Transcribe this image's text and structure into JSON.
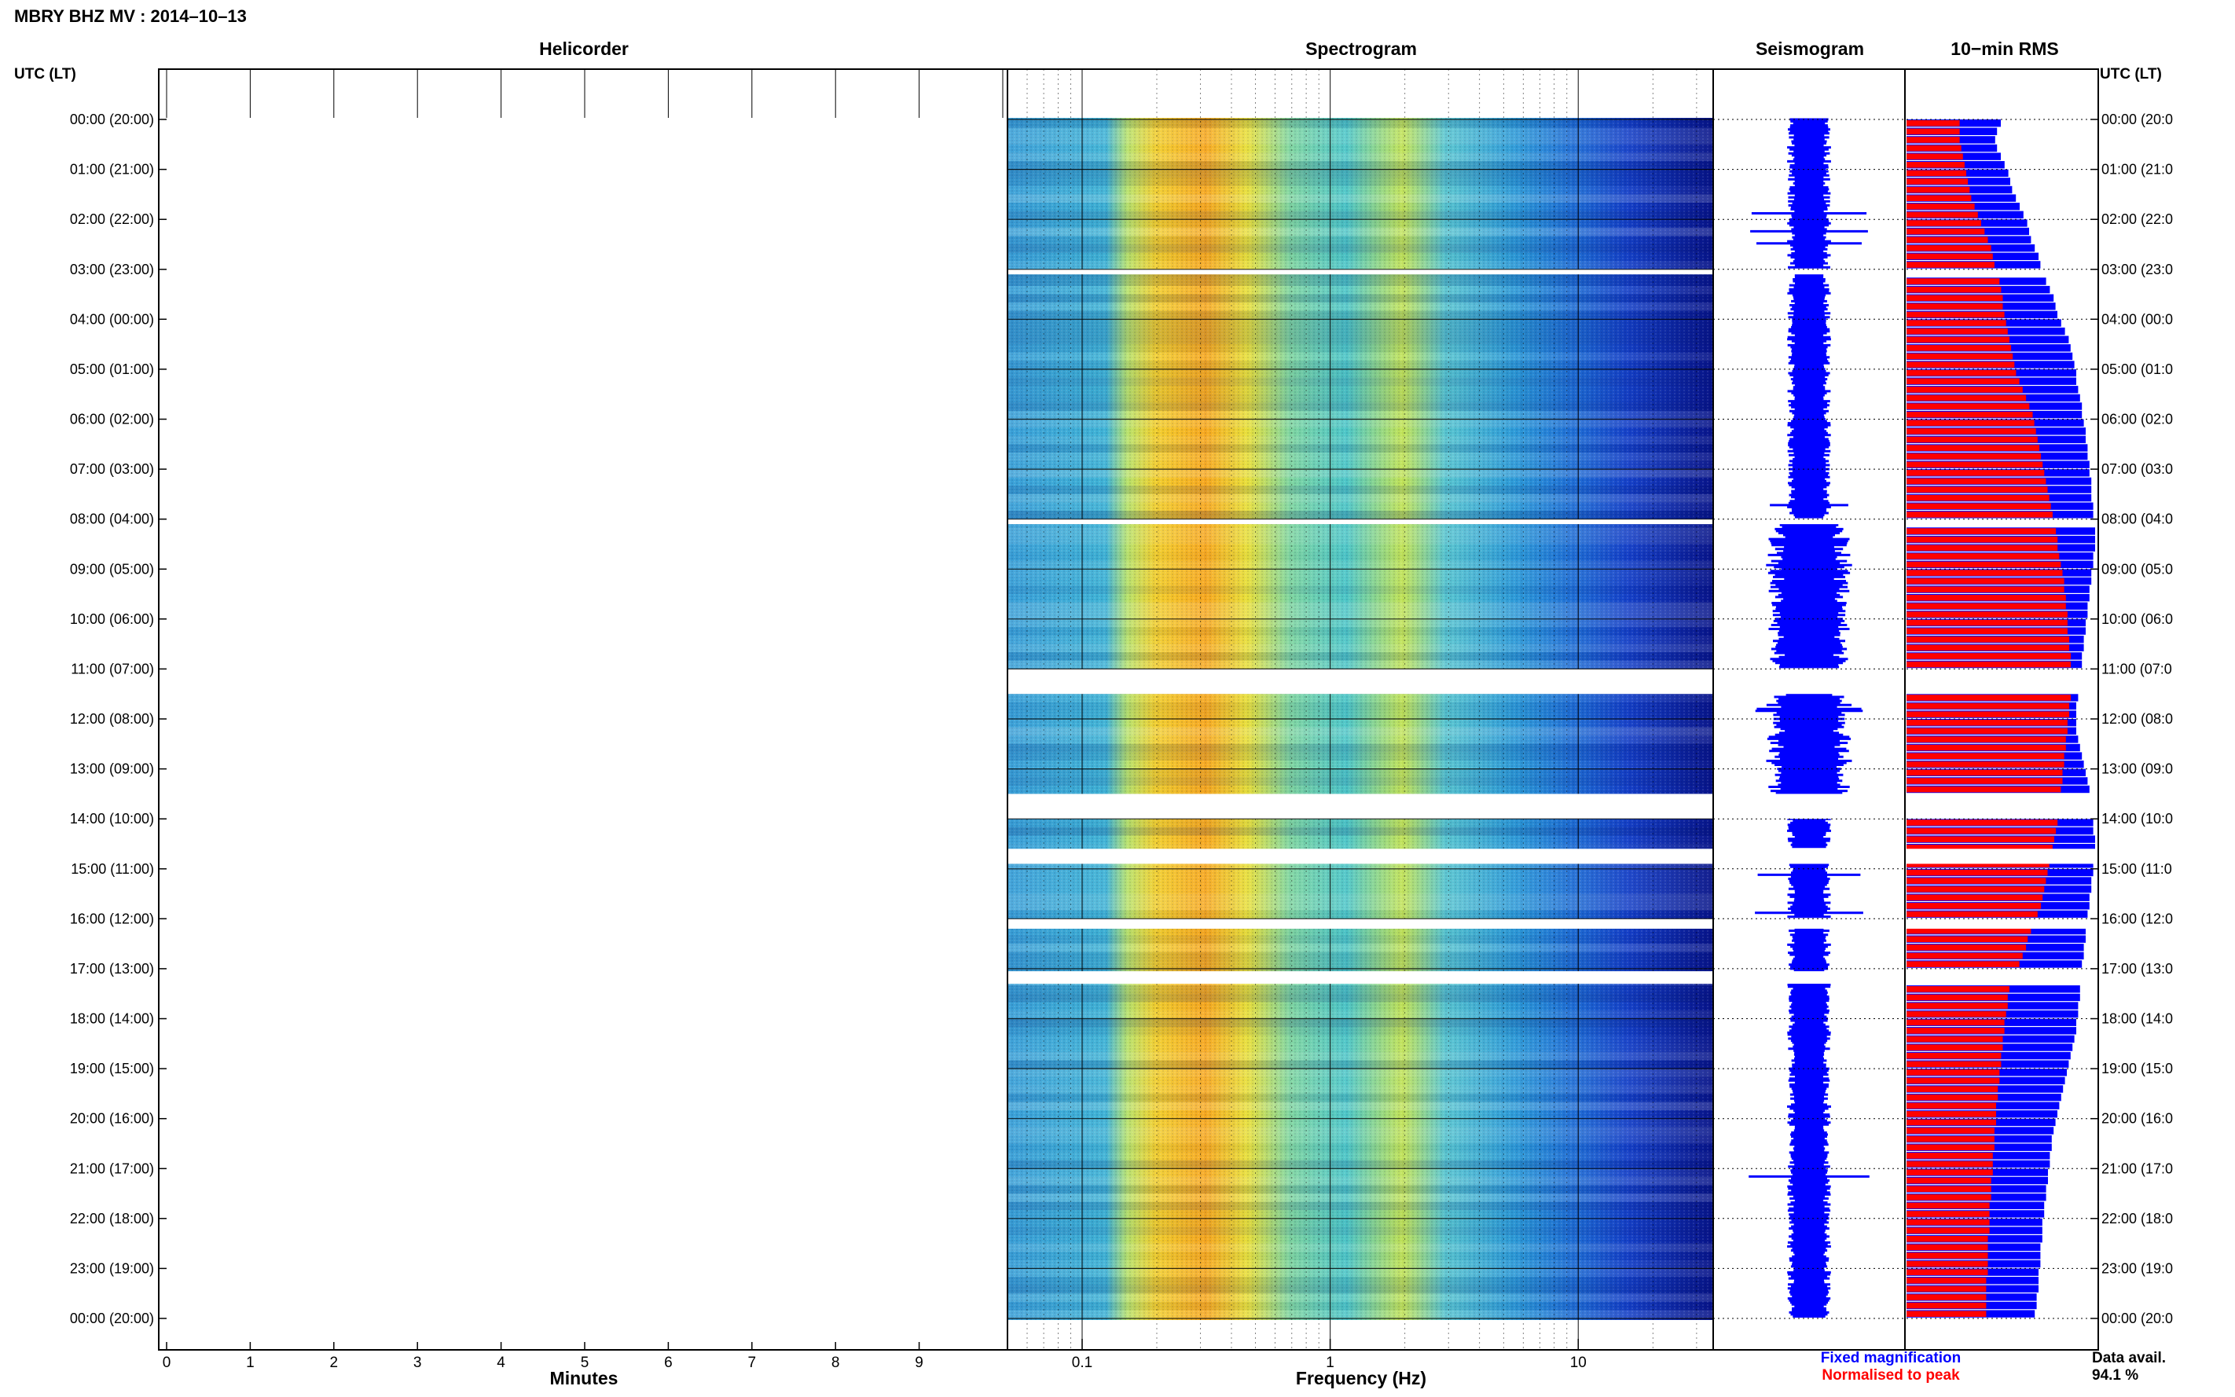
{
  "header": {
    "title": "MBRY BHZ MV : 2014–10–13"
  },
  "time_axis": {
    "label_left": "UTC (LT)",
    "label_right": "UTC (LT)",
    "ticks": [
      "00:00 (20:00)",
      "01:00 (21:00)",
      "02:00 (22:00)",
      "03:00 (23:00)",
      "04:00 (00:00)",
      "05:00 (01:00)",
      "06:00 (02:00)",
      "07:00 (03:00)",
      "08:00 (04:00)",
      "09:00 (05:00)",
      "10:00 (06:00)",
      "11:00 (07:00)",
      "12:00 (08:00)",
      "13:00 (09:00)",
      "14:00 (10:00)",
      "15:00 (11:00)",
      "16:00 (12:00)",
      "17:00 (13:00)",
      "18:00 (14:00)",
      "19:00 (15:00)",
      "20:00 (16:00)",
      "21:00 (17:00)",
      "22:00 (18:00)",
      "23:00 (19:00)",
      "00:00 (20:00)"
    ],
    "ticks_right": [
      "00:00 (20:0",
      "01:00 (21:0",
      "02:00 (22:0",
      "03:00 (23:0",
      "04:00 (00:0",
      "05:00 (01:0",
      "06:00 (02:0",
      "07:00 (03:0",
      "08:00 (04:0",
      "09:00 (05:0",
      "10:00 (06:0",
      "11:00 (07:0",
      "12:00 (08:0",
      "13:00 (09:0",
      "14:00 (10:0",
      "15:00 (11:0",
      "16:00 (12:0",
      "17:00 (13:0",
      "18:00 (14:0",
      "19:00 (15:0",
      "20:00 (16:0",
      "21:00 (17:0",
      "22:00 (18:0",
      "23:00 (19:0",
      "00:00 (20:0"
    ]
  },
  "panels": {
    "helicorder": {
      "title": "Helicorder",
      "xlabel": "Minutes",
      "xticks": [
        "0",
        "1",
        "2",
        "3",
        "4",
        "5",
        "6",
        "7",
        "8",
        "9"
      ]
    },
    "spectrogram": {
      "title": "Spectrogram",
      "xlabel": "Frequency (Hz)",
      "xticks": [
        "0.1",
        "1",
        "10"
      ]
    },
    "seismogram": {
      "title": "Seismogram"
    },
    "rms": {
      "title": "10−min RMS"
    }
  },
  "legend": {
    "fixed": "Fixed magnification",
    "normalised": "Normalised to peak",
    "fixed_color": "#0000ff",
    "normalised_color": "#ff0000"
  },
  "availability": {
    "label": "Data avail.",
    "value": "94.1 %"
  },
  "chart_data": {
    "type": "heatmap",
    "time_range_hours": [
      0,
      24
    ],
    "helicorder": {
      "minutes_range": [
        0,
        10
      ],
      "trace_colors": [
        "#000000",
        "#8b0000",
        "#0000cd",
        "#008000"
      ]
    },
    "spectrogram": {
      "frequency_range_hz": [
        0.05,
        35
      ],
      "scale": "log",
      "peak_band_hz": [
        0.2,
        0.4
      ]
    },
    "data_gaps_hours": [
      [
        3.0,
        3.1
      ],
      [
        8.0,
        8.1
      ],
      [
        11.0,
        11.5
      ],
      [
        13.5,
        14.0
      ],
      [
        14.6,
        14.9
      ],
      [
        16.0,
        16.2
      ],
      [
        17.05,
        17.3
      ]
    ],
    "rms": {
      "normalised_to_peak": [
        0.32,
        0.32,
        0.32,
        0.33,
        0.34,
        0.35,
        0.36,
        0.37,
        0.38,
        0.39,
        0.41,
        0.43,
        0.45,
        0.47,
        0.49,
        0.51,
        0.52,
        0.53,
        0.55,
        0.56,
        0.57,
        0.58,
        0.58,
        0.59,
        0.6,
        0.61,
        0.62,
        0.63,
        0.64,
        0.65,
        0.66,
        0.68,
        0.7,
        0.72,
        0.74,
        0.76,
        0.77,
        0.78,
        0.79,
        0.8,
        0.81,
        0.82,
        0.83,
        0.84,
        0.85,
        0.86,
        0.87,
        0.88,
        0.89,
        0.9,
        0.91,
        0.91,
        0.92,
        0.93,
        0.94,
        0.95,
        0.95,
        0.96,
        0.96,
        0.97,
        0.97,
        0.97,
        0.98,
        0.98,
        0.99,
        0.99,
        0.99,
        1,
        0.99,
        0.99,
        0.98,
        0.98,
        0.97,
        0.97,
        0.96,
        0.96,
        0.95,
        0.95,
        0.94,
        0.94,
        0.93,
        0.93,
        0.92,
        0.92,
        0.91,
        0.9,
        0.89,
        0.88,
        0.87,
        0.86,
        0.85,
        0.84,
        0.83,
        0.82,
        0.81,
        0.79,
        0.77,
        0.75,
        0.73,
        0.72,
        0.7,
        0.68,
        0.66,
        0.64,
        0.62,
        0.61,
        0.61,
        0.6,
        0.59,
        0.59,
        0.58,
        0.58,
        0.57,
        0.57,
        0.56,
        0.56,
        0.55,
        0.55,
        0.54,
        0.54,
        0.54,
        0.53,
        0.53,
        0.53,
        0.52,
        0.52,
        0.52,
        0.51,
        0.51,
        0.51,
        0.5,
        0.5,
        0.5,
        0.5,
        0.49,
        0.49,
        0.49,
        0.49,
        0.49,
        0.48,
        0.48,
        0.48,
        0.48,
        0.48
      ],
      "fixed_magnification": [
        0.5,
        0.48,
        0.47,
        0.48,
        0.5,
        0.52,
        0.54,
        0.55,
        0.56,
        0.58,
        0.6,
        0.62,
        0.64,
        0.65,
        0.66,
        0.68,
        0.7,
        0.71,
        0.72,
        0.74,
        0.76,
        0.78,
        0.79,
        0.8,
        0.82,
        0.84,
        0.86,
        0.87,
        0.88,
        0.89,
        0.9,
        0.9,
        0.91,
        0.92,
        0.93,
        0.93,
        0.94,
        0.95,
        0.95,
        0.96,
        0.96,
        0.97,
        0.97,
        0.98,
        0.98,
        0.98,
        0.99,
        0.99,
        0.99,
        1,
        1,
        1,
        0.99,
        0.99,
        0.98,
        0.98,
        0.97,
        0.97,
        0.96,
        0.96,
        0.95,
        0.95,
        0.94,
        0.94,
        0.93,
        0.93,
        0.92,
        0.92,
        0.91,
        0.91,
        0.9,
        0.9,
        0.9,
        0.9,
        0.91,
        0.92,
        0.93,
        0.94,
        0.95,
        0.96,
        0.97,
        0.97,
        0.98,
        0.98,
        0.99,
        0.99,
        1,
        1,
        1,
        0.99,
        0.99,
        0.98,
        0.98,
        0.97,
        0.97,
        0.96,
        0.96,
        0.95,
        0.95,
        0.94,
        0.94,
        0.93,
        0.93,
        0.92,
        0.92,
        0.92,
        0.91,
        0.91,
        0.9,
        0.9,
        0.89,
        0.88,
        0.87,
        0.86,
        0.85,
        0.84,
        0.83,
        0.82,
        0.81,
        0.8,
        0.79,
        0.78,
        0.77,
        0.77,
        0.76,
        0.76,
        0.75,
        0.75,
        0.74,
        0.74,
        0.73,
        0.73,
        0.72,
        0.72,
        0.72,
        0.71,
        0.71,
        0.71,
        0.7,
        0.7,
        0.7,
        0.69,
        0.69,
        0.68
      ]
    }
  }
}
